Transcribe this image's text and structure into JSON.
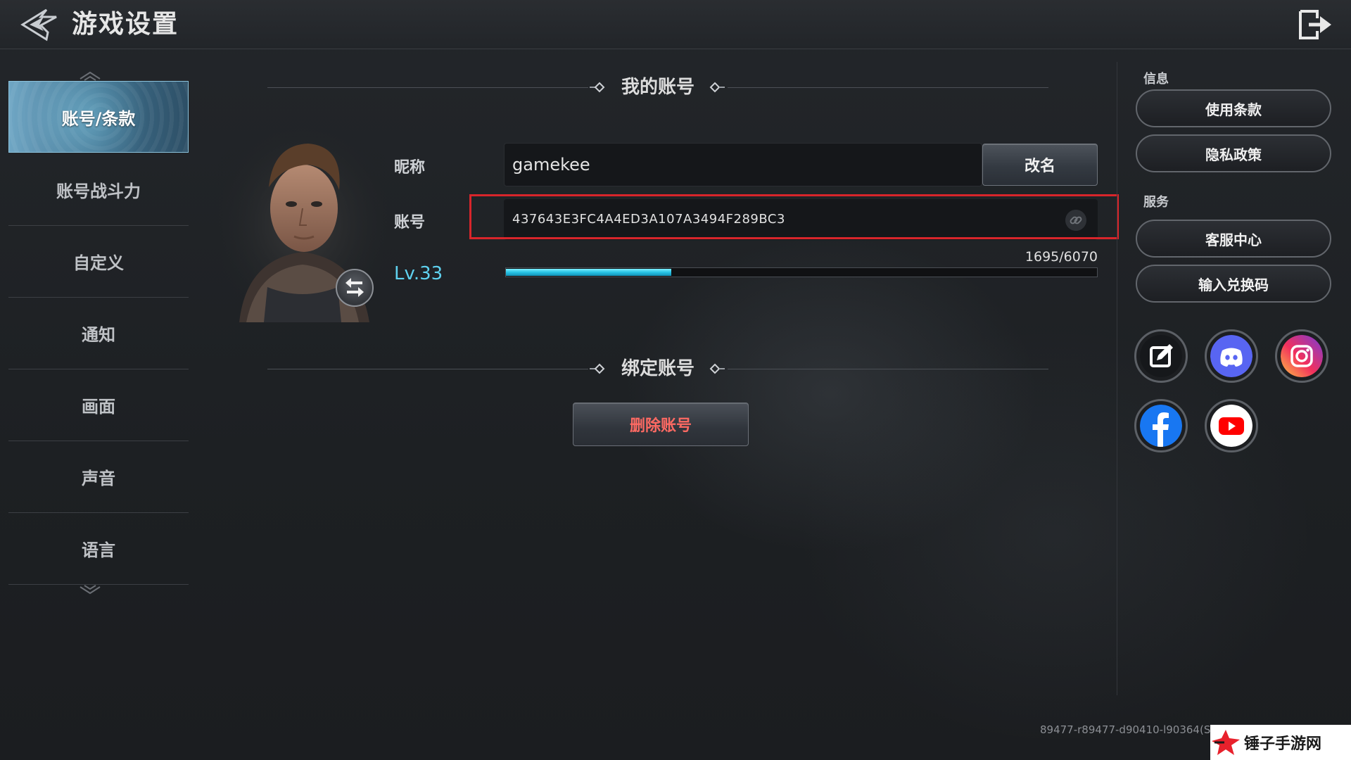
{
  "header": {
    "title": "游戏设置"
  },
  "menu": {
    "items": [
      {
        "label": "账号/条款",
        "active": true
      },
      {
        "label": "账号战斗力",
        "active": false
      },
      {
        "label": "自定义",
        "active": false
      },
      {
        "label": "通知",
        "active": false
      },
      {
        "label": "画面",
        "active": false
      },
      {
        "label": "声音",
        "active": false
      },
      {
        "label": "语言",
        "active": false
      }
    ]
  },
  "account": {
    "section_title": "我的账号",
    "nickname_label": "昵称",
    "nickname_value": "gamekee",
    "rename_label": "改名",
    "account_label": "账号",
    "account_id": "437643E3FC4A4ED3A107A3494F289BC3",
    "level": "Lv.33",
    "exp_text": "1695/6070",
    "exp_current": 1695,
    "exp_max": 6070
  },
  "binding": {
    "section_title": "绑定账号",
    "delete_label": "删除账号"
  },
  "right_panel": {
    "info_label": "信息",
    "info_buttons": [
      "使用条款",
      "隐私政策"
    ],
    "service_label": "服务",
    "service_buttons": [
      "客服中心",
      "输入兑换码"
    ],
    "social_icons": [
      "edit-icon",
      "discord-icon",
      "instagram-icon",
      "facebook-icon",
      "youtube-icon"
    ]
  },
  "footer": {
    "build_info": "89477-r89477-d90410-l90364(S",
    "watermark": "锤子手游网"
  },
  "colors": {
    "accent": "#5fd2f0",
    "danger": "#ff6a63",
    "highlight": "#d8252b"
  }
}
